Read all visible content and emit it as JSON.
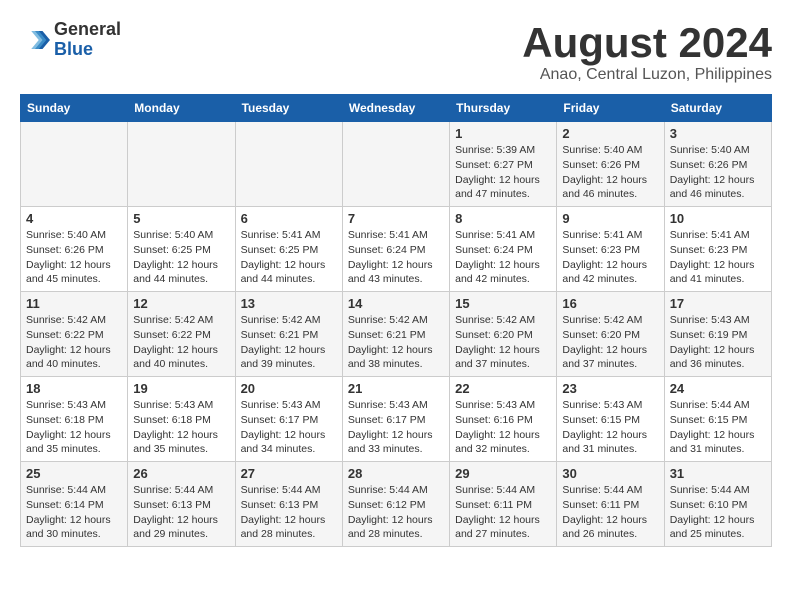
{
  "header": {
    "logo_general": "General",
    "logo_blue": "Blue",
    "title": "August 2024",
    "subtitle": "Anao, Central Luzon, Philippines"
  },
  "calendar": {
    "days_of_week": [
      "Sunday",
      "Monday",
      "Tuesday",
      "Wednesday",
      "Thursday",
      "Friday",
      "Saturday"
    ],
    "weeks": [
      [
        {
          "day": "",
          "info": ""
        },
        {
          "day": "",
          "info": ""
        },
        {
          "day": "",
          "info": ""
        },
        {
          "day": "",
          "info": ""
        },
        {
          "day": "1",
          "info": "Sunrise: 5:39 AM\nSunset: 6:27 PM\nDaylight: 12 hours and 47 minutes."
        },
        {
          "day": "2",
          "info": "Sunrise: 5:40 AM\nSunset: 6:26 PM\nDaylight: 12 hours and 46 minutes."
        },
        {
          "day": "3",
          "info": "Sunrise: 5:40 AM\nSunset: 6:26 PM\nDaylight: 12 hours and 46 minutes."
        }
      ],
      [
        {
          "day": "4",
          "info": "Sunrise: 5:40 AM\nSunset: 6:26 PM\nDaylight: 12 hours and 45 minutes."
        },
        {
          "day": "5",
          "info": "Sunrise: 5:40 AM\nSunset: 6:25 PM\nDaylight: 12 hours and 44 minutes."
        },
        {
          "day": "6",
          "info": "Sunrise: 5:41 AM\nSunset: 6:25 PM\nDaylight: 12 hours and 44 minutes."
        },
        {
          "day": "7",
          "info": "Sunrise: 5:41 AM\nSunset: 6:24 PM\nDaylight: 12 hours and 43 minutes."
        },
        {
          "day": "8",
          "info": "Sunrise: 5:41 AM\nSunset: 6:24 PM\nDaylight: 12 hours and 42 minutes."
        },
        {
          "day": "9",
          "info": "Sunrise: 5:41 AM\nSunset: 6:23 PM\nDaylight: 12 hours and 42 minutes."
        },
        {
          "day": "10",
          "info": "Sunrise: 5:41 AM\nSunset: 6:23 PM\nDaylight: 12 hours and 41 minutes."
        }
      ],
      [
        {
          "day": "11",
          "info": "Sunrise: 5:42 AM\nSunset: 6:22 PM\nDaylight: 12 hours and 40 minutes."
        },
        {
          "day": "12",
          "info": "Sunrise: 5:42 AM\nSunset: 6:22 PM\nDaylight: 12 hours and 40 minutes."
        },
        {
          "day": "13",
          "info": "Sunrise: 5:42 AM\nSunset: 6:21 PM\nDaylight: 12 hours and 39 minutes."
        },
        {
          "day": "14",
          "info": "Sunrise: 5:42 AM\nSunset: 6:21 PM\nDaylight: 12 hours and 38 minutes."
        },
        {
          "day": "15",
          "info": "Sunrise: 5:42 AM\nSunset: 6:20 PM\nDaylight: 12 hours and 37 minutes."
        },
        {
          "day": "16",
          "info": "Sunrise: 5:42 AM\nSunset: 6:20 PM\nDaylight: 12 hours and 37 minutes."
        },
        {
          "day": "17",
          "info": "Sunrise: 5:43 AM\nSunset: 6:19 PM\nDaylight: 12 hours and 36 minutes."
        }
      ],
      [
        {
          "day": "18",
          "info": "Sunrise: 5:43 AM\nSunset: 6:18 PM\nDaylight: 12 hours and 35 minutes."
        },
        {
          "day": "19",
          "info": "Sunrise: 5:43 AM\nSunset: 6:18 PM\nDaylight: 12 hours and 35 minutes."
        },
        {
          "day": "20",
          "info": "Sunrise: 5:43 AM\nSunset: 6:17 PM\nDaylight: 12 hours and 34 minutes."
        },
        {
          "day": "21",
          "info": "Sunrise: 5:43 AM\nSunset: 6:17 PM\nDaylight: 12 hours and 33 minutes."
        },
        {
          "day": "22",
          "info": "Sunrise: 5:43 AM\nSunset: 6:16 PM\nDaylight: 12 hours and 32 minutes."
        },
        {
          "day": "23",
          "info": "Sunrise: 5:43 AM\nSunset: 6:15 PM\nDaylight: 12 hours and 31 minutes."
        },
        {
          "day": "24",
          "info": "Sunrise: 5:44 AM\nSunset: 6:15 PM\nDaylight: 12 hours and 31 minutes."
        }
      ],
      [
        {
          "day": "25",
          "info": "Sunrise: 5:44 AM\nSunset: 6:14 PM\nDaylight: 12 hours and 30 minutes."
        },
        {
          "day": "26",
          "info": "Sunrise: 5:44 AM\nSunset: 6:13 PM\nDaylight: 12 hours and 29 minutes."
        },
        {
          "day": "27",
          "info": "Sunrise: 5:44 AM\nSunset: 6:13 PM\nDaylight: 12 hours and 28 minutes."
        },
        {
          "day": "28",
          "info": "Sunrise: 5:44 AM\nSunset: 6:12 PM\nDaylight: 12 hours and 28 minutes."
        },
        {
          "day": "29",
          "info": "Sunrise: 5:44 AM\nSunset: 6:11 PM\nDaylight: 12 hours and 27 minutes."
        },
        {
          "day": "30",
          "info": "Sunrise: 5:44 AM\nSunset: 6:11 PM\nDaylight: 12 hours and 26 minutes."
        },
        {
          "day": "31",
          "info": "Sunrise: 5:44 AM\nSunset: 6:10 PM\nDaylight: 12 hours and 25 minutes."
        }
      ]
    ]
  }
}
